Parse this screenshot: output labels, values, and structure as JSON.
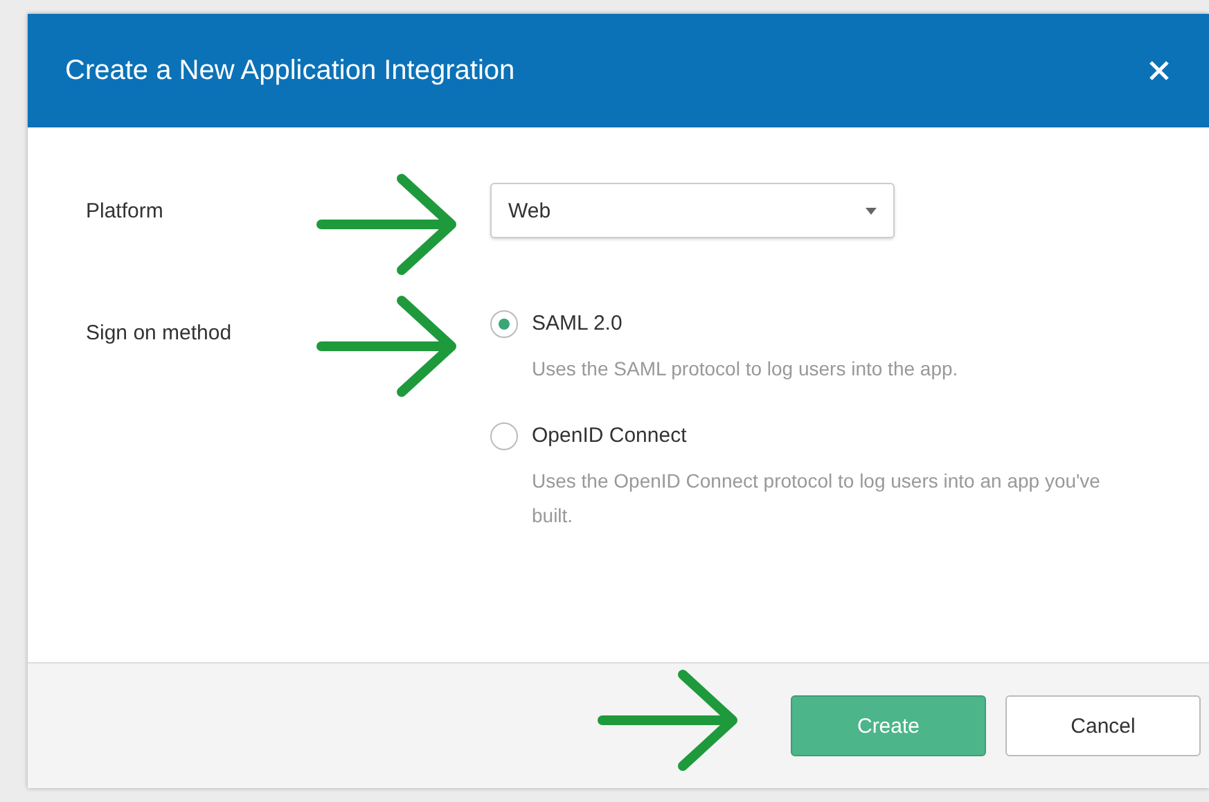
{
  "dialog": {
    "title": "Create a New Application Integration"
  },
  "platform": {
    "label": "Platform",
    "value": "Web"
  },
  "sign_on": {
    "label": "Sign on method",
    "options": [
      {
        "label": "SAML 2.0",
        "description": "Uses the SAML protocol to log users into the app.",
        "selected": true
      },
      {
        "label": "OpenID Connect",
        "description": "Uses the OpenID Connect protocol to log users into an app you've built.",
        "selected": false
      }
    ]
  },
  "buttons": [
    {
      "label": "Create",
      "kind": "primary"
    },
    {
      "label": "Cancel",
      "kind": "secondary"
    }
  ]
}
